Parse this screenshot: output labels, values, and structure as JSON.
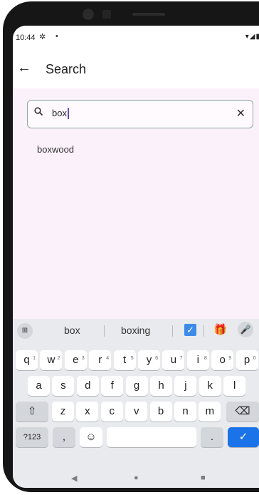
{
  "status": {
    "time": "10:44",
    "icons": "▾◢▮"
  },
  "appbar": {
    "title": "Search"
  },
  "search": {
    "query": "box",
    "suggestion": "boxwood"
  },
  "keyboard": {
    "suggestions": [
      "box",
      "boxing"
    ],
    "row1": [
      {
        "k": "q",
        "h": "1"
      },
      {
        "k": "w",
        "h": "2"
      },
      {
        "k": "e",
        "h": "3"
      },
      {
        "k": "r",
        "h": "4"
      },
      {
        "k": "t",
        "h": "5"
      },
      {
        "k": "y",
        "h": "6"
      },
      {
        "k": "u",
        "h": "7"
      },
      {
        "k": "i",
        "h": "8"
      },
      {
        "k": "o",
        "h": "9"
      },
      {
        "k": "p",
        "h": "0"
      }
    ],
    "row2": [
      "a",
      "s",
      "d",
      "f",
      "g",
      "h",
      "j",
      "k",
      "l"
    ],
    "row3": [
      "z",
      "x",
      "c",
      "v",
      "b",
      "n",
      "m"
    ],
    "symbols_label": "?123",
    "comma": ",",
    "period": "."
  },
  "colors": {
    "content_bg": "#fbf1fb",
    "search_border": "#8fa99b",
    "enter_key": "#1a73e8",
    "keyboard_bg": "#e8eaed"
  },
  "icons": {
    "back": "arrow-left-icon",
    "search": "search-icon",
    "clear": "close-icon",
    "shift": "shift-icon",
    "backspace": "backspace-icon",
    "emoji": "emoji-icon",
    "enter": "checkmark-icon",
    "mic": "mic-icon",
    "grid": "apps-grid-icon",
    "clipboard": "checkbox-icon",
    "gift": "gift-icon"
  }
}
